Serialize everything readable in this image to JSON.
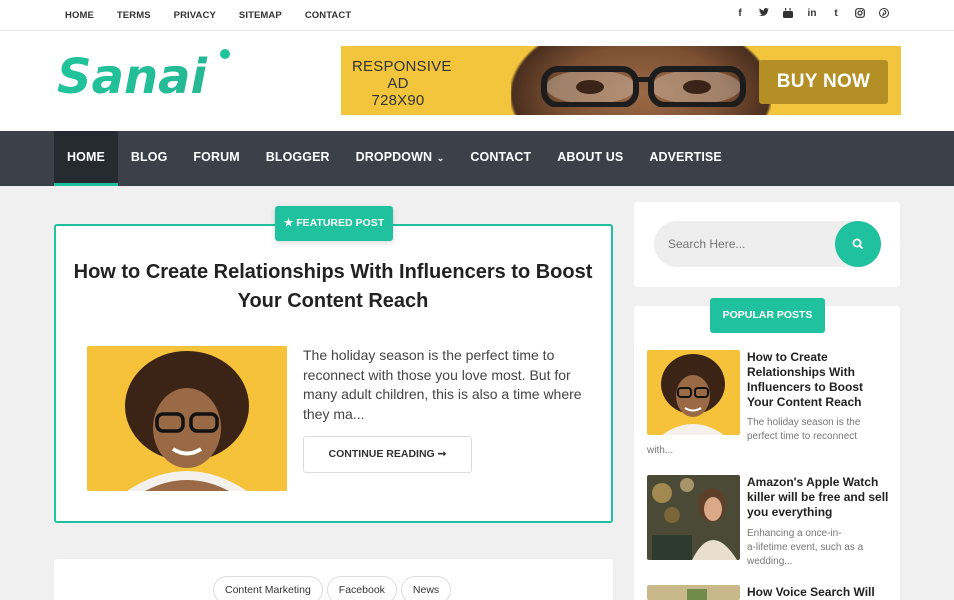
{
  "topbar": {
    "links": [
      "HOME",
      "TERMS",
      "PRIVACY",
      "SITEMAP",
      "CONTACT"
    ],
    "social_icons": [
      {
        "name": "facebook-icon",
        "glyph": "f"
      },
      {
        "name": "twitter-icon",
        "glyph": "t"
      },
      {
        "name": "youtube-icon",
        "glyph": "▶"
      },
      {
        "name": "linkedin-icon",
        "glyph": "in"
      },
      {
        "name": "tumblr-icon",
        "glyph": "t"
      },
      {
        "name": "instagram-icon",
        "glyph": "◎"
      },
      {
        "name": "pinterest-icon",
        "glyph": "℗"
      }
    ]
  },
  "header": {
    "logo_text": "Sanai",
    "ad_line1": "RESPONSIVE AD",
    "ad_line2": "728X90",
    "ad_button": "BUY NOW"
  },
  "nav": {
    "items": [
      "HOME",
      "BLOG",
      "FORUM",
      "BLOGGER",
      "DROPDOWN",
      "CONTACT",
      "ABOUT US",
      "ADVERTISE"
    ],
    "active": "HOME"
  },
  "featured": {
    "badge": "FEATURED POST",
    "title": "How to Create Relationships With Influencers to Boost Your Content Reach",
    "excerpt": "The holiday season is the perfect time to reconnect with those you love most. But for many adult children, this is also a time where they ma...",
    "continue_label": "CONTINUE READING"
  },
  "tags": [
    "Content Marketing",
    "Facebook",
    "News"
  ],
  "sidebar": {
    "search_placeholder": "Search Here...",
    "popular_label": "POPULAR POSTS",
    "posts": [
      {
        "title": "How to Create Relationships With Influencers to Boost Your Content Reach",
        "excerpt_line1": "The holiday season is the",
        "excerpt_line2": "perfect time to reconnect",
        "excerpt_line3": "with..."
      },
      {
        "title": "Amazon's Apple Watch killer will be free and sell you everything",
        "excerpt_line1": "Enhancing a once-in-",
        "excerpt_line2": "a-lifetime event, such as a",
        "excerpt_line3": "wedding..."
      },
      {
        "title": "How Voice Search Will"
      }
    ]
  },
  "colors": {
    "accent": "#20c19e",
    "nav_bg": "#3b4049",
    "ad_bg": "#f2c53c"
  }
}
